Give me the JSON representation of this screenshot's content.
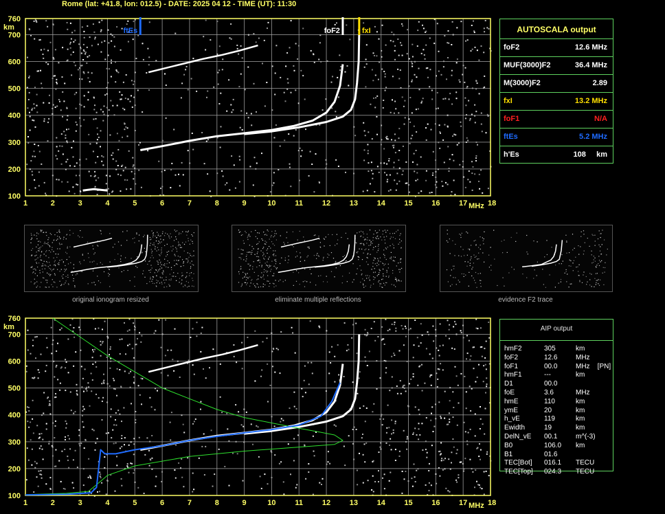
{
  "header": "Rome (lat: +41.8, lon: 012.5) - DATE: 2025 04 12 - TIME (UT): 11:30",
  "colors": {
    "grid": "#a8a8a8",
    "axis": "#ffff66",
    "panel_border": "#5fd35f",
    "white": "#ffffff",
    "blue": "#1e6bff",
    "yellow": "#ffe000",
    "green": "#2ee02e",
    "red": "#ff2020"
  },
  "chart_data": [
    {
      "type": "scatter",
      "name": "ionogram-top",
      "xlabel": "MHz",
      "ylabel": "km",
      "xlim": [
        1,
        18
      ],
      "ylim": [
        100,
        760
      ],
      "x_ticks": [
        "1",
        "2",
        "3",
        "4",
        "5",
        "6",
        "7",
        "8",
        "9",
        "10",
        "11",
        "12",
        "13",
        "14",
        "15",
        "16",
        "17",
        "18"
      ],
      "y_ticks": [
        "100",
        "200",
        "300",
        "400",
        "500",
        "600",
        "700",
        "760"
      ],
      "grid": true,
      "markers": [
        {
          "label": "ftEs",
          "x": 5.2,
          "color": "#1e6bff"
        },
        {
          "label": "foF2",
          "x": 12.6,
          "color": "#ffffff"
        },
        {
          "label": "fxI",
          "x": 13.2,
          "color": "#ffe000"
        }
      ],
      "trace_o": {
        "x": [
          5.2,
          6,
          7,
          8,
          9,
          10,
          10.8,
          11.5,
          12,
          12.3,
          12.5,
          12.6
        ],
        "y": [
          270,
          285,
          305,
          322,
          333,
          345,
          360,
          380,
          410,
          450,
          510,
          590
        ]
      },
      "trace_x": {
        "x": [
          9,
          10,
          11,
          12,
          12.6,
          12.9,
          13.05,
          13.12,
          13.18,
          13.2
        ],
        "y": [
          330,
          340,
          355,
          375,
          395,
          420,
          460,
          520,
          600,
          700
        ]
      },
      "trace_2hop": {
        "x": [
          5.5,
          6.5,
          7.5,
          8.2,
          8.8,
          9.5
        ],
        "y": [
          560,
          585,
          610,
          625,
          640,
          660
        ]
      },
      "trace_es": {
        "x": [
          3.1,
          3.5,
          4.0
        ],
        "y": [
          120,
          125,
          120
        ]
      }
    },
    {
      "type": "line",
      "name": "ionogram-bottom",
      "xlabel": "MHz",
      "ylabel": "km",
      "xlim": [
        1,
        18
      ],
      "ylim": [
        100,
        760
      ],
      "x_ticks": [
        "1",
        "2",
        "3",
        "4",
        "5",
        "6",
        "7",
        "8",
        "9",
        "10",
        "11",
        "12",
        "13",
        "14",
        "15",
        "16",
        "17",
        "18"
      ],
      "y_ticks": [
        "100",
        "200",
        "300",
        "400",
        "500",
        "600",
        "700",
        "760"
      ],
      "grid": true,
      "trace_o": {
        "x": [
          5.2,
          6,
          7,
          8,
          9,
          10,
          10.8,
          11.5,
          12,
          12.3,
          12.5,
          12.6
        ],
        "y": [
          270,
          285,
          305,
          322,
          333,
          345,
          360,
          380,
          410,
          450,
          510,
          590
        ]
      },
      "trace_x": {
        "x": [
          9,
          10,
          11,
          12,
          12.6,
          12.9,
          13.05,
          13.12,
          13.18,
          13.2
        ],
        "y": [
          330,
          340,
          355,
          375,
          395,
          420,
          460,
          520,
          600,
          700
        ]
      },
      "trace_2hop": {
        "x": [
          5.5,
          6.5,
          7.5,
          8.2,
          8.8,
          9.5
        ],
        "y": [
          560,
          585,
          610,
          625,
          640,
          660
        ]
      },
      "profile_blue": {
        "x": [
          1,
          2.5,
          3.4,
          3.6,
          3.75,
          3.9,
          4.3,
          5,
          6,
          7,
          8,
          9,
          10,
          11,
          11.8,
          12.2,
          12.5
        ],
        "y": [
          102,
          104,
          110,
          130,
          270,
          255,
          255,
          270,
          285,
          305,
          320,
          333,
          345,
          362,
          395,
          450,
          520
        ]
      },
      "profile_green": {
        "x": [
          2,
          3,
          4,
          5,
          6,
          7,
          8,
          9,
          10,
          11,
          11.8,
          12.3,
          12.6,
          12.3,
          11,
          9,
          7,
          5,
          4,
          3.6,
          3.3,
          2.5,
          1
        ],
        "y": [
          760,
          690,
          620,
          560,
          500,
          460,
          420,
          390,
          370,
          350,
          335,
          325,
          305,
          290,
          280,
          265,
          245,
          210,
          175,
          140,
          115,
          108,
          103
        ]
      }
    }
  ],
  "autoscala": {
    "title": "AUTOSCALA output",
    "rows": [
      {
        "label": "foF2",
        "value": "12.6 MHz",
        "color": "#ffffff"
      },
      {
        "label": "MUF(3000)F2",
        "value": "36.4 MHz",
        "color": "#ffffff"
      },
      {
        "label": "M(3000)F2",
        "value": "2.89",
        "color": "#ffffff"
      },
      {
        "label": "fxI",
        "value": "13.2 MHz",
        "color": "#ffe000"
      },
      {
        "label": "foF1",
        "value": "N/A",
        "color": "#ff2020"
      },
      {
        "label": "ftEs",
        "value": "5.2 MHz",
        "color": "#1e6bff"
      },
      {
        "label": "h'Es",
        "value": "108     km",
        "color": "#ffffff"
      }
    ]
  },
  "thumbnails": [
    {
      "caption": "original ionogram resized"
    },
    {
      "caption": "eliminate multiple reflections"
    },
    {
      "caption": "evidence F2 trace"
    }
  ],
  "aip": {
    "title": "AIP output",
    "rows": [
      {
        "name": "hmF2",
        "value": "305",
        "unit": "km"
      },
      {
        "name": "foF2",
        "value": "12.6",
        "unit": "MHz"
      },
      {
        "name": "foF1",
        "value": "00.0",
        "unit": "MHz    [PN]"
      },
      {
        "name": "hmF1",
        "value": "---",
        "unit": "km"
      },
      {
        "name": "D1",
        "value": "00.0",
        "unit": ""
      },
      {
        "name": "foE",
        "value": "3.6",
        "unit": "MHz"
      },
      {
        "name": "hmE",
        "value": "110",
        "unit": "km"
      },
      {
        "name": "ymE",
        "value": "20",
        "unit": "km"
      },
      {
        "name": "h_vE",
        "value": "119",
        "unit": "km"
      },
      {
        "name": "Ewidth",
        "value": "19",
        "unit": "km"
      },
      {
        "name": "DelN_vE",
        "value": "00.1",
        "unit": "m^(-3)"
      },
      {
        "name": "B0",
        "value": "106.0",
        "unit": "km"
      },
      {
        "name": "B1",
        "value": "01.6",
        "unit": ""
      },
      {
        "name": "TEC[Bot]",
        "value": "016.1",
        "unit": "TECU"
      },
      {
        "name": "TEC[Top]",
        "value": "024.3",
        "unit": "TECU"
      }
    ]
  }
}
